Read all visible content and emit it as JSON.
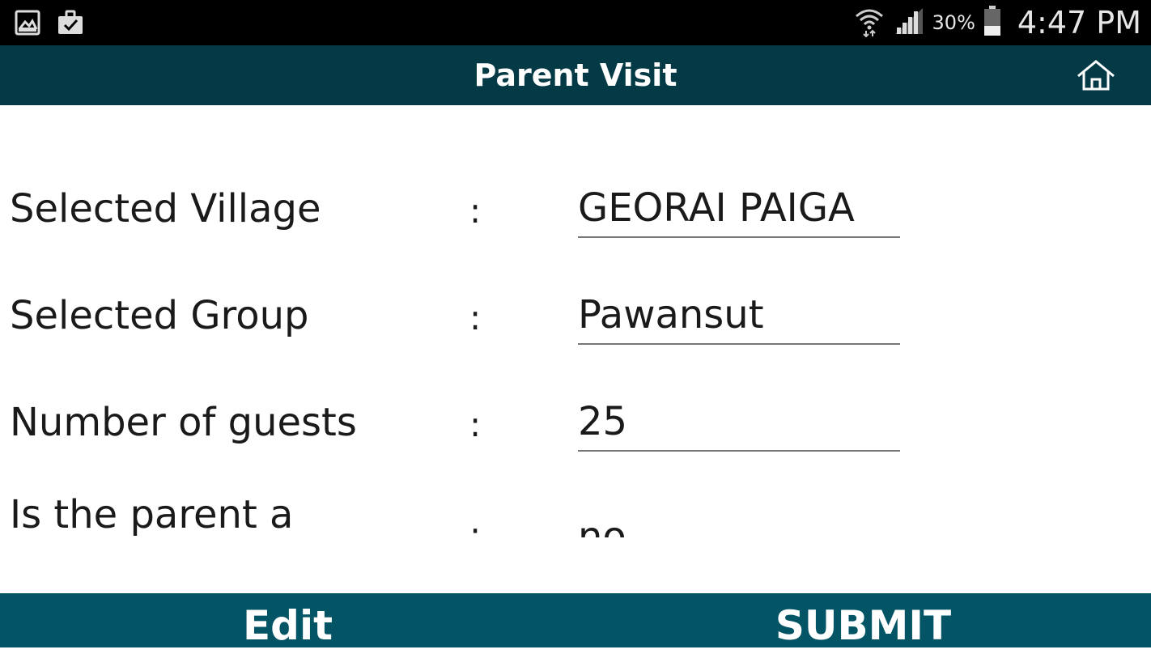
{
  "status_bar": {
    "icons_left": [
      "gallery-icon",
      "clipboard-check-icon"
    ],
    "icons_right": [
      "wifi-icon",
      "signal-icon",
      "battery-icon"
    ],
    "battery_percent": "30%",
    "time": "4:47 PM"
  },
  "toolbar": {
    "title": "Parent Visit",
    "home_icon": "home-icon",
    "background": "#033a45"
  },
  "form": {
    "rows": [
      {
        "label": "Selected Village",
        "colon": ":",
        "value": "GEORAI PAIGA"
      },
      {
        "label": "Selected Group",
        "colon": ":",
        "value": "Pawansut"
      },
      {
        "label": "Number of guests",
        "colon": ":",
        "value": "25"
      },
      {
        "label": "Is the parent a",
        "colon": ":",
        "value": "no"
      }
    ]
  },
  "bottom_bar": {
    "edit_label": "Edit",
    "submit_label": "SUBMIT",
    "background": "#035566"
  }
}
